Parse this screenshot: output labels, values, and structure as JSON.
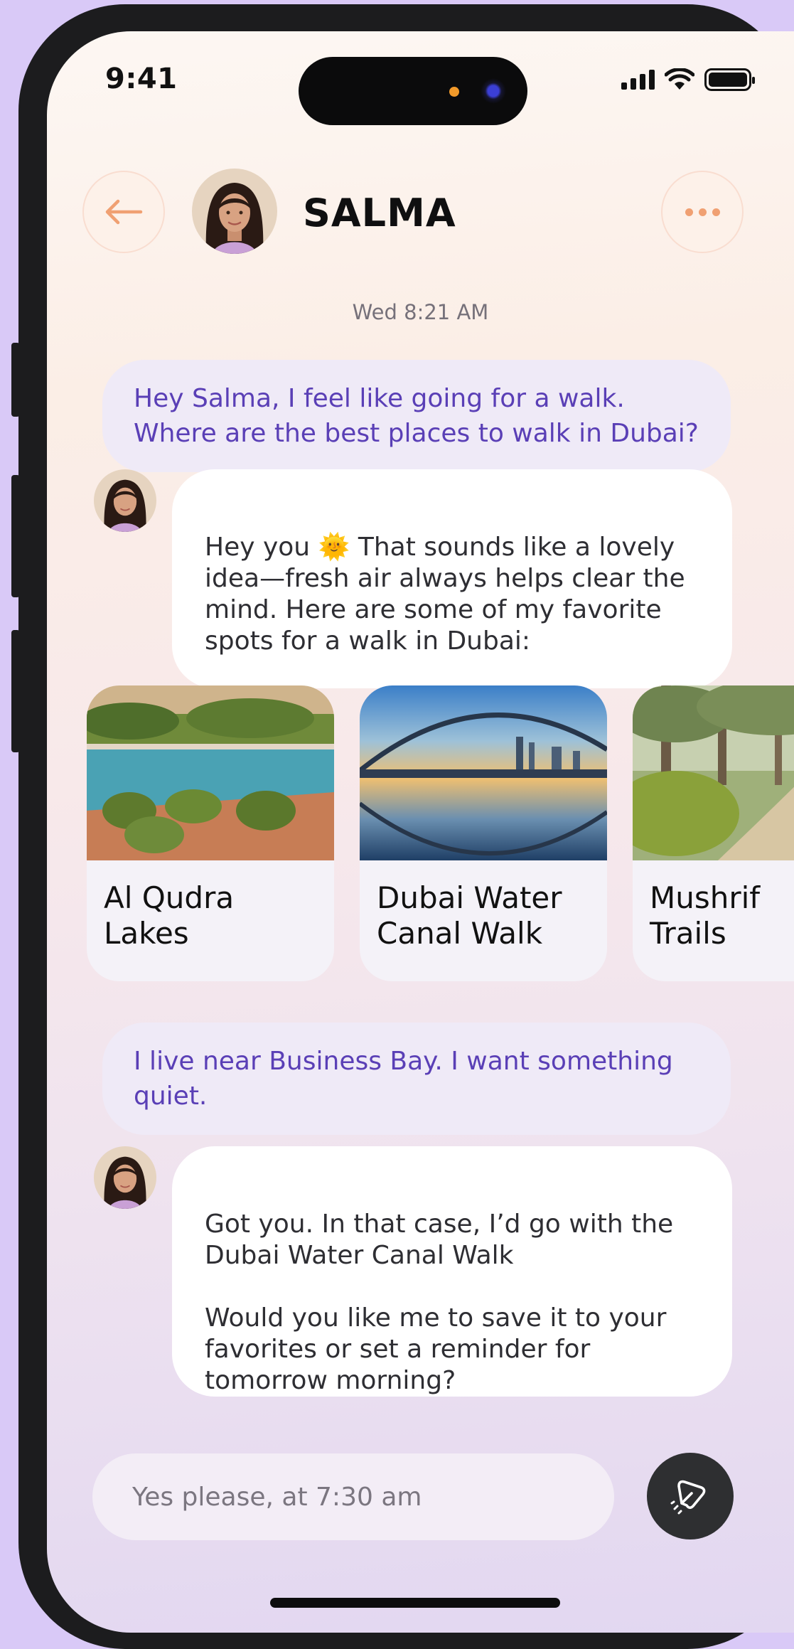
{
  "status_bar": {
    "time": "9:41"
  },
  "header": {
    "contact_name": "SALMA",
    "timestamp": "Wed 8:21 AM",
    "back_icon": "arrow-left-icon",
    "more_icon": "more-horizontal-icon"
  },
  "messages": [
    {
      "from": "user",
      "text": "Hey Salma, I feel like going for a walk. Where are the best places to walk in Dubai?"
    },
    {
      "from": "salma",
      "text_before_emoji": "Hey you ",
      "emoji": "🌞",
      "text_after_emoji": " That sounds like a lovely idea—fresh air always helps clear the mind. Here are some of my favorite spots for a walk in Dubai:"
    },
    {
      "from": "user",
      "text": "I live near Business Bay. I want something quiet."
    },
    {
      "from": "salma",
      "text": "Got you. In that case, I’d go with the Dubai Water Canal Walk\n\nWould you like me to save it to your favorites or set a reminder for tomorrow morning?"
    }
  ],
  "places": [
    {
      "name": "Al Qudra\nLakes"
    },
    {
      "name": "Dubai Water\nCanal Walk"
    },
    {
      "name": "Mushrif\nTrails"
    }
  ],
  "composer": {
    "value": "Yes please, at 7:30 am",
    "send_icon": "send-icon"
  },
  "colors": {
    "user_text": "#5a3fb6",
    "accent_orange": "#f0a072",
    "send_button": "#2e2f31"
  }
}
